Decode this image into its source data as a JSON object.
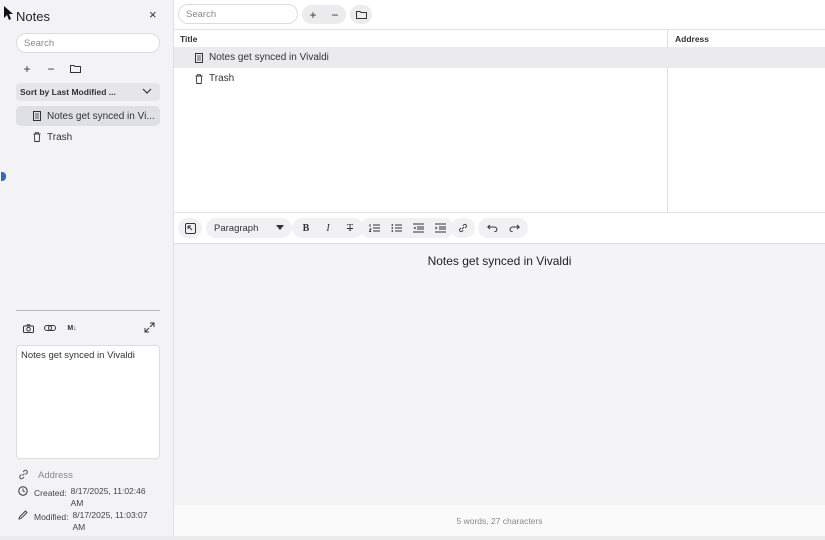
{
  "panel": {
    "title": "Notes",
    "close_glyph": "×",
    "search_placeholder": "Search",
    "add_glyph": "+",
    "remove_glyph": "−",
    "sort_label": "Sort by Last Modified ...",
    "items": [
      {
        "label": "Notes get synced in Vi...",
        "icon": "note-icon",
        "active": true
      },
      {
        "label": "Trash",
        "icon": "trash-icon",
        "active": false
      }
    ],
    "editor_tools": {
      "markdown_label": "M↓"
    },
    "note_text": "Notes get synced in Vivaldi",
    "address_label": "Address",
    "created_label": "Created:",
    "created_value": "8/17/2025, 11:02:46 AM",
    "modified_label": "Modified:",
    "modified_value": "8/17/2025, 11:03:07 AM"
  },
  "main": {
    "search_placeholder": "Search",
    "add_glyph": "+",
    "remove_glyph": "−",
    "columns": [
      "Title",
      "Address"
    ],
    "rows": [
      {
        "title": "Notes get synced in Vivaldi",
        "address": "",
        "selected": true
      },
      {
        "title": "Trash",
        "address": "",
        "selected": false
      }
    ],
    "toolbar": {
      "paragraph_label": "Paragraph",
      "bold": "B",
      "italic": "I",
      "strike": "T"
    },
    "document_text": "Notes get synced in Vivaldi",
    "status": "5 words, 27 characters"
  },
  "colors": {
    "accent": "#2a6bcb",
    "sidebar_bg": "#f3f3f5",
    "selected_bg": "#dfe0e6"
  }
}
